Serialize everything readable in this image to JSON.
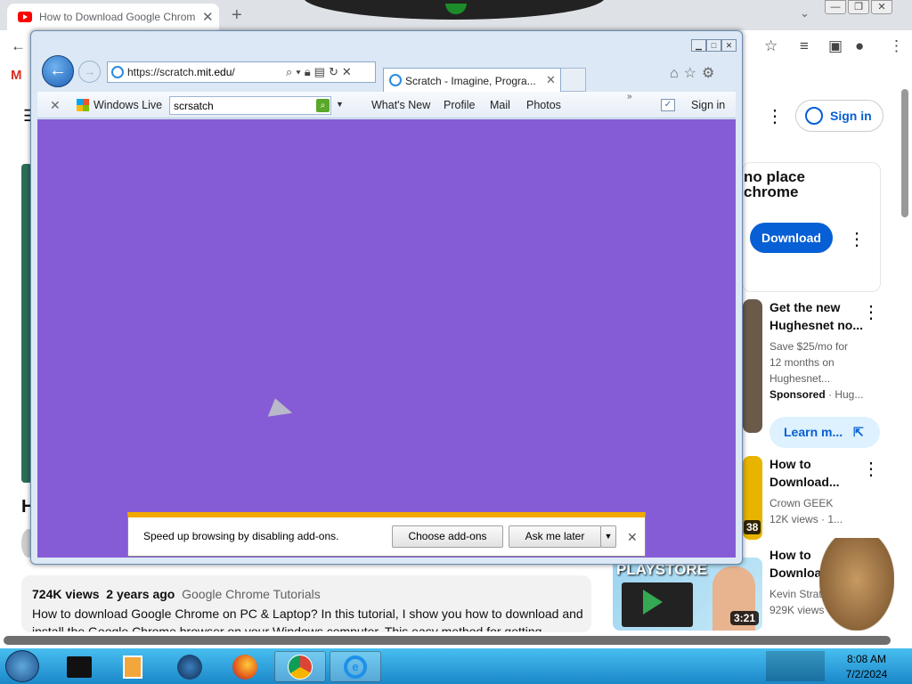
{
  "chrome": {
    "tab_title": "How to Download Google Chrome",
    "tab_close": "✕",
    "new_tab": "+",
    "gmail_letter": "M"
  },
  "youtube": {
    "sign_in": "Sign in",
    "ad_headline": "no place\nchrome",
    "download_label": "Download",
    "ad2": {
      "title": "Get the new Hughesnet no...",
      "line1": "Save $25/mo for",
      "line2": "12 months on",
      "line3": "Hughesnet...",
      "sponsored": "Sponsored",
      "advertiser": "· Hug..."
    },
    "learn_more": "Learn m...",
    "video1": {
      "title": "How to Download...",
      "channel": "Crown GEEK",
      "meta": "12K views · 1..."
    },
    "video2": {
      "title": "How to Download...",
      "channel": "Kevin Stratv...",
      "meta": "929K views"
    },
    "thumb_durations": [
      "38",
      "3:21"
    ],
    "playstore_label": "PLAYSTORE",
    "description": {
      "meta_views": "724K views",
      "meta_age": "2 years ago",
      "meta_channel": "Google Chrome Tutorials",
      "text": "How to download Google Chrome on PC & Laptop? In this tutorial, I show you how to download and install the Google Chrome browser on your Windows computer. This easy method for getting"
    },
    "left_heading_letter": "H"
  },
  "ie": {
    "url_prefix": "https://scratch.",
    "url_domain": "mit.edu",
    "url_suffix": "/",
    "tab_title": "Scratch - Imagine, Progra...",
    "windows_live": "Windows Live",
    "search_value": "scrsatch",
    "links": [
      "What's New",
      "Profile",
      "Mail",
      "Photos"
    ],
    "sign_in": "Sign in",
    "more": "»"
  },
  "notification": {
    "message": "Speed up browsing by disabling add-ons.",
    "choose": "Choose add-ons",
    "ask_later": "Ask me later"
  },
  "taskbar": {
    "time": "8:08 AM",
    "date": "7/2/2024"
  }
}
